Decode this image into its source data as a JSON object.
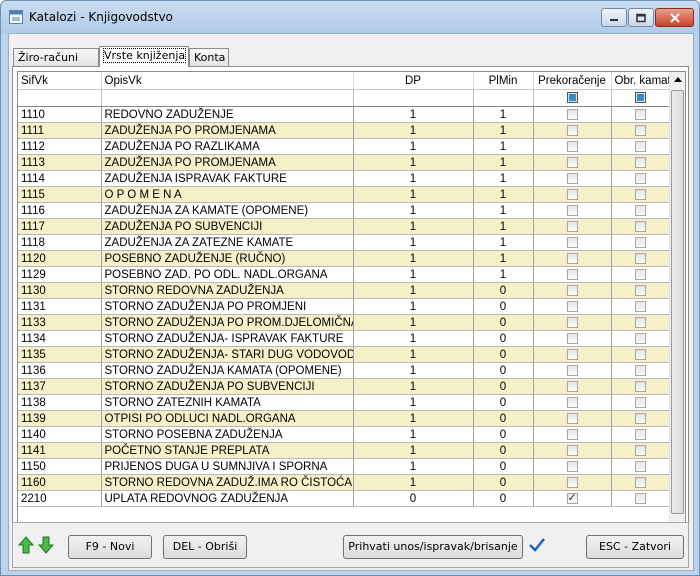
{
  "window": {
    "title": "Katalozi - Knjigovodstvo"
  },
  "tabs": [
    "Žiro-računi",
    "Vrste knjiženja",
    "Konta"
  ],
  "active_tab": 1,
  "grid": {
    "columns": [
      "SifVk",
      "OpisVk",
      "DP",
      "PlMin",
      "Prekoračenje",
      "Obr. kamata"
    ],
    "rows": [
      {
        "sif": "1110",
        "opis": "REDOVNO ZADUŽENJE",
        "dp": "1",
        "plmin": "1",
        "prek": false,
        "kamata": false
      },
      {
        "sif": "1111",
        "opis": "ZADUŽENJA PO PROMJENAMA",
        "dp": "1",
        "plmin": "1",
        "prek": false,
        "kamata": false
      },
      {
        "sif": "1112",
        "opis": "ZADUŽENJA PO RAZLIKAMA",
        "dp": "1",
        "plmin": "1",
        "prek": false,
        "kamata": false
      },
      {
        "sif": "1113",
        "opis": "ZADUŽENJA PO PROMJENAMA",
        "dp": "1",
        "plmin": "1",
        "prek": false,
        "kamata": false
      },
      {
        "sif": "1114",
        "opis": "ZADUŽENJA ISPRAVAK FAKTURE",
        "dp": "1",
        "plmin": "1",
        "prek": false,
        "kamata": false
      },
      {
        "sif": "1115",
        "opis": "O P O M E N A",
        "dp": "1",
        "plmin": "1",
        "prek": false,
        "kamata": false
      },
      {
        "sif": "1116",
        "opis": "ZADUŽENJA ZA KAMATE (OPOMENE)",
        "dp": "1",
        "plmin": "1",
        "prek": false,
        "kamata": false
      },
      {
        "sif": "1117",
        "opis": "ZADUŽENJA PO SUBVENCIJI",
        "dp": "1",
        "plmin": "1",
        "prek": false,
        "kamata": false
      },
      {
        "sif": "1118",
        "opis": "ZADUŽENJA ZA ZATEZNE KAMATE",
        "dp": "1",
        "plmin": "1",
        "prek": false,
        "kamata": false
      },
      {
        "sif": "1120",
        "opis": "POSEBNO ZADUŽENJE (RUČNO)",
        "dp": "1",
        "plmin": "1",
        "prek": false,
        "kamata": false
      },
      {
        "sif": "1129",
        "opis": "POSEBNO ZAD. PO ODL. NADL.ORGANA",
        "dp": "1",
        "plmin": "1",
        "prek": false,
        "kamata": false
      },
      {
        "sif": "1130",
        "opis": "STORNO REDOVNA ZADUŽENJA",
        "dp": "1",
        "plmin": "0",
        "prek": false,
        "kamata": false
      },
      {
        "sif": "1131",
        "opis": "STORNO ZADUŽENJA PO PROMJENI",
        "dp": "1",
        "plmin": "0",
        "prek": false,
        "kamata": false
      },
      {
        "sif": "1133",
        "opis": "STORNO ZADUŽENJA PO PROM.DJELOMIČNA",
        "dp": "1",
        "plmin": "0",
        "prek": false,
        "kamata": false
      },
      {
        "sif": "1134",
        "opis": "STORNO ZADUŽENJA- ISPRAVAK FAKTURE",
        "dp": "1",
        "plmin": "0",
        "prek": false,
        "kamata": false
      },
      {
        "sif": "1135",
        "opis": "STORNO ZADUŽENJA- STARI DUG VODOVOD",
        "dp": "1",
        "plmin": "0",
        "prek": false,
        "kamata": false
      },
      {
        "sif": "1136",
        "opis": "STORNO ZADUŽENJA KAMATA (OPOMENE)",
        "dp": "1",
        "plmin": "0",
        "prek": false,
        "kamata": false
      },
      {
        "sif": "1137",
        "opis": "STORNO ZADUŽENJA PO SUBVENCIJI",
        "dp": "1",
        "plmin": "0",
        "prek": false,
        "kamata": false
      },
      {
        "sif": "1138",
        "opis": "STORNO ZATEZNIH KAMATA",
        "dp": "1",
        "plmin": "0",
        "prek": false,
        "kamata": false
      },
      {
        "sif": "1139",
        "opis": "OTPISI PO ODLUCI NADL.ORGANA",
        "dp": "1",
        "plmin": "0",
        "prek": false,
        "kamata": false
      },
      {
        "sif": "1140",
        "opis": "STORNO POSEBNA ZADUŽENJA",
        "dp": "1",
        "plmin": "0",
        "prek": false,
        "kamata": false
      },
      {
        "sif": "1141",
        "opis": "POČETNO STANJE PREPLATA",
        "dp": "1",
        "plmin": "0",
        "prek": false,
        "kamata": false
      },
      {
        "sif": "1150",
        "opis": "PRIJENOS DUGA U SUMNJIVA I SPORNA",
        "dp": "1",
        "plmin": "0",
        "prek": false,
        "kamata": false
      },
      {
        "sif": "1160",
        "opis": "STORNO REDOVNA ZADUŽ.IMA RO ČISTOĆA",
        "dp": "1",
        "plmin": "0",
        "prek": false,
        "kamata": false
      },
      {
        "sif": "2210",
        "opis": "UPLATA REDOVNOG ZADUŽENJA",
        "dp": "0",
        "plmin": "0",
        "prek": true,
        "kamata": false
      }
    ]
  },
  "buttons": {
    "new": "F9 - Novi",
    "delete": "DEL - Obriši",
    "accept": "Prihvati unos/ispravak/brisanje",
    "close": "ESC - Zatvori"
  },
  "icons": {
    "app": "app-window-icon",
    "up": "arrow-up-icon",
    "down": "arrow-down-icon",
    "confirm": "checkmark-icon"
  },
  "colors": {
    "row_highlight": "#f4f1c8",
    "arrow_green": "#3aa13a",
    "check_blue": "#1e5fc8"
  }
}
